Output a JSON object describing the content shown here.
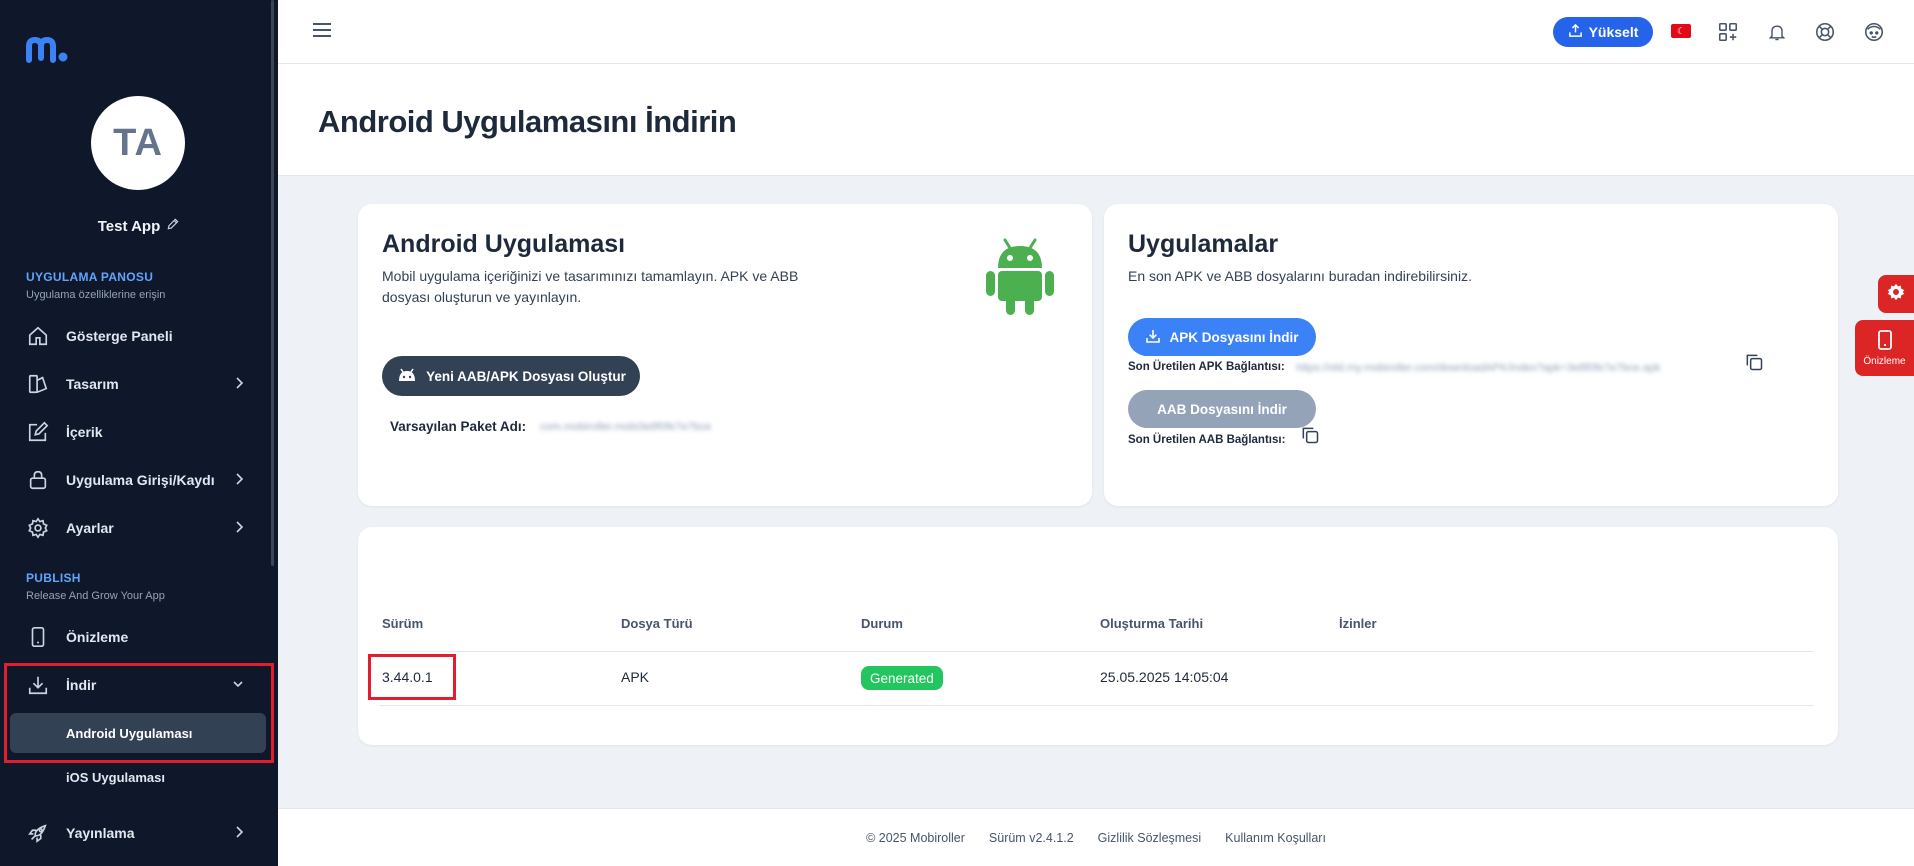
{
  "sidebar": {
    "avatar_initials": "TA",
    "app_name": "Test App",
    "section1_title": "UYGULAMA PANOSU",
    "section1_sub": "Uygulama özelliklerine erişin",
    "items": [
      {
        "label": "Gösterge Paneli",
        "icon": "home-icon"
      },
      {
        "label": "Tasarım",
        "icon": "palette-icon"
      },
      {
        "label": "İçerik",
        "icon": "edit-icon"
      },
      {
        "label": "Uygulama Girişi/Kaydı",
        "icon": "lock-icon"
      },
      {
        "label": "Ayarlar",
        "icon": "gear-icon"
      }
    ],
    "section2_title": "PUBLISH",
    "section2_sub": "Release And Grow Your App",
    "publish_items": [
      {
        "label": "Önizleme",
        "icon": "phone-icon"
      },
      {
        "label": "İndir",
        "icon": "download-icon"
      }
    ],
    "sub_items": [
      {
        "label": "Android Uygulaması"
      },
      {
        "label": "iOS Uygulaması"
      }
    ],
    "last_item": {
      "label": "Yayınlama",
      "icon": "rocket-icon"
    }
  },
  "topbar": {
    "upgrade_label": "Yükselt",
    "flag_symbol": "☾"
  },
  "page": {
    "title": "Android Uygulamasını İndirin"
  },
  "android_card": {
    "title": "Android Uygulaması",
    "desc": "Mobil uygulama içeriğinizi ve tasarımınızı tamamlayın. APK ve ABB dosyası oluşturun ve yayınlayın.",
    "create_button": "Yeni AAB/APK Dosyası Oluştur",
    "package_label": "Varsayılan Paket Adı:",
    "package_value": "com.mobiroller.mobi3e8f0fe7e7bce"
  },
  "apps_card": {
    "title": "Uygulamalar",
    "desc": "En son APK ve ABB dosyalarını buradan indirebilirsiniz.",
    "apk_button": "APK Dosyasını İndir",
    "apk_link_label": "Son Üretilen APK Bağlantısı:",
    "apk_link_value": "https://old.my.mobiroller.com/downloadAPK/index?apk=3e8f0fe7e7bce.apk",
    "aab_button": "AAB Dosyasını İndir",
    "aab_link_label": "Son Üretilen AAB Bağlantısı:"
  },
  "table": {
    "headers": [
      "Sürüm",
      "Dosya Türü",
      "Durum",
      "Oluşturma Tarihi",
      "İzinler"
    ],
    "rows": [
      {
        "version": "3.44.0.1",
        "file_type": "APK",
        "status": "Generated",
        "created": "25.05.2025 14:05:04",
        "permissions": ""
      }
    ]
  },
  "float": {
    "preview_label": "Önizleme"
  },
  "footer": {
    "copyright": "© 2025 Mobiroller",
    "version": "Sürüm v2.4.1.2",
    "privacy": "Gizlilik Sözleşmesi",
    "terms": "Kullanım Koşulları"
  },
  "colors": {
    "sidebar_bg": "#0f172a",
    "accent": "#2563eb",
    "highlight": "#e11d2e",
    "success": "#22c55e",
    "android_green": "#4caf50"
  }
}
